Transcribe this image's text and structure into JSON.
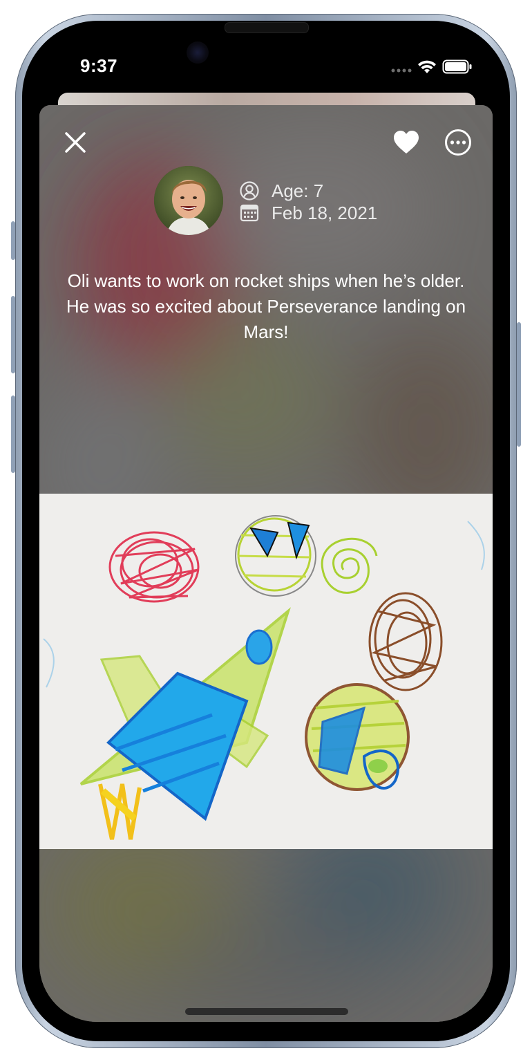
{
  "status_bar": {
    "time": "9:37"
  },
  "header": {
    "close_icon": "close-icon",
    "favorite_icon": "heart-icon",
    "more_icon": "ellipsis-circle-icon"
  },
  "profile": {
    "avatar_icon": "child-photo",
    "age_icon": "person-circle-icon",
    "age_label": "Age: 7",
    "date_icon": "calendar-icon",
    "date_label": "Feb 18, 2021"
  },
  "caption": "Oli wants to work on rocket ships when he’s older. He was so excited about Perseverance landing on Mars!",
  "artwork": {
    "kind": "crayon-drawing"
  }
}
